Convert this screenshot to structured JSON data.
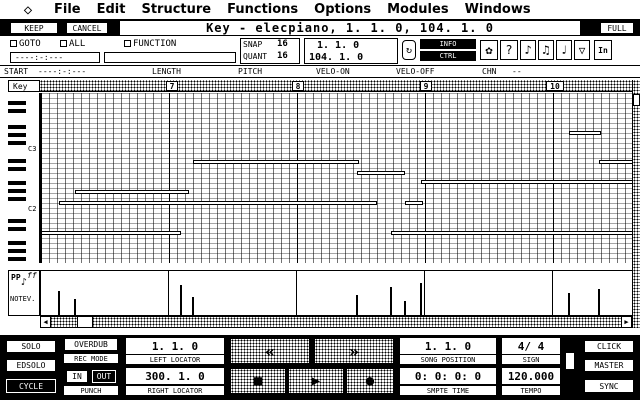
{
  "menu": {
    "items": [
      "File",
      "Edit",
      "Structure",
      "Functions",
      "Options",
      "Modules",
      "Windows"
    ]
  },
  "toolbar": {
    "keep": "KEEP",
    "cancel": "CANCEL",
    "full": "FULL",
    "title": "Key - elecpiano,   1. 1.  0,  104. 1.  0"
  },
  "filters": {
    "goto": "GOTO",
    "all": "ALL",
    "function": "FUNCTION",
    "position": "----:-:---",
    "snap_label": "SNAP",
    "snap_value": "16",
    "quant_label": "QUANT",
    "quant_value": "16",
    "start_pos": "1.  1.    0",
    "end_pos": "104.  1.    0",
    "info": "INFO",
    "ctrl": "CTRL",
    "in_label": "In"
  },
  "columns": {
    "start": "START",
    "start_val": "----:-:---",
    "length": "LENGTH",
    "pitch": "PITCH",
    "velo_on": "VELO-ON",
    "velo_off": "VELO-OFF",
    "chn": "CHN",
    "chn_val": "--"
  },
  "ruler": {
    "key_label": "Key",
    "bars": [
      "7",
      "8",
      "9",
      "10"
    ]
  },
  "keyboard": {
    "c3": "C3",
    "c2": "C2"
  },
  "controller": {
    "label_pp": "PP",
    "label_ff": "ff",
    "notev": "NOTEV."
  },
  "transport": {
    "solo": "SOLO",
    "edsolo": "EDSOLO",
    "cycle": "CYCLE",
    "overdub": "OVERDUB",
    "rec_mode": "REC MODE",
    "in": "IN",
    "out": "OUT",
    "punch": "PUNCH",
    "left_locator_val": "1.  1.    0",
    "left_locator": "LEFT LOCATOR",
    "right_locator_val": "300.  1.    0",
    "right_locator": "RIGHT LOCATOR",
    "song_position_val": "1.  1.    0",
    "song_position": "SONG POSITION",
    "smpte_val": "0:  0:  0:  0",
    "smpte_time": "SMPTE TIME",
    "sign_val": "4/ 4",
    "sign": "SIGN",
    "tempo_val": "120.000",
    "tempo": "TEMPO",
    "click": "CLICK",
    "master": "MASTER",
    "sync": "SYNC"
  }
}
